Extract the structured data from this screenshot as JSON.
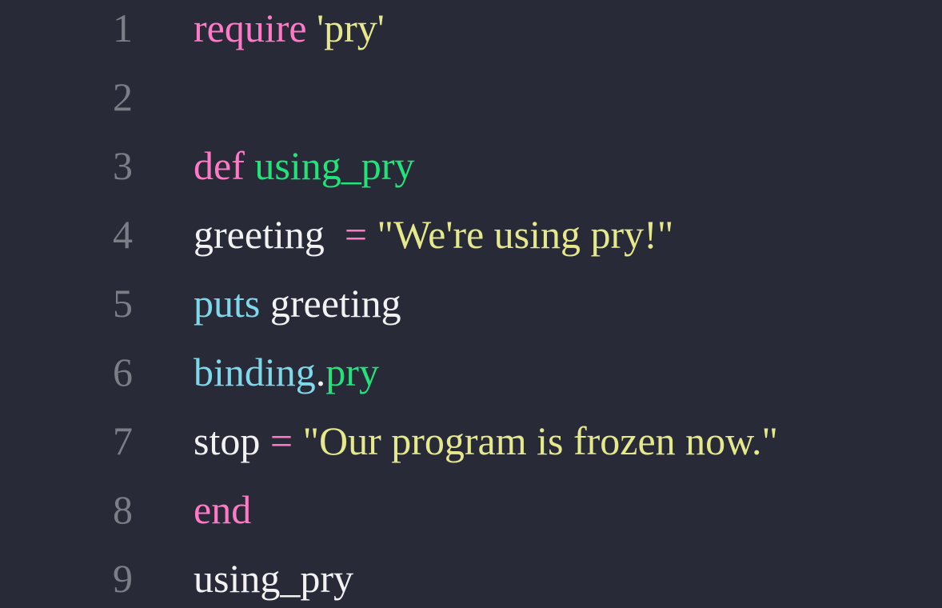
{
  "editor": {
    "colors": {
      "background": "#282a38",
      "line_number": "#7b7e87",
      "keyword": "#ff79c6",
      "string": "#e6e88c",
      "method": "#22e37a",
      "identifier": "#f2f2f2",
      "builtin": "#7fd7ea"
    },
    "lines": [
      {
        "number": "1",
        "tokens": [
          {
            "text": "require",
            "kind": "keyword"
          },
          {
            "text": " ",
            "kind": "identifier"
          },
          {
            "text": "'pry'",
            "kind": "string"
          }
        ]
      },
      {
        "number": "2",
        "tokens": []
      },
      {
        "number": "3",
        "tokens": [
          {
            "text": "def",
            "kind": "keyword"
          },
          {
            "text": " ",
            "kind": "identifier"
          },
          {
            "text": "using_pry",
            "kind": "method"
          }
        ]
      },
      {
        "number": "4",
        "tokens": [
          {
            "text": "greeting  ",
            "kind": "identifier"
          },
          {
            "text": "=",
            "kind": "keyword"
          },
          {
            "text": " ",
            "kind": "identifier"
          },
          {
            "text": "\"We're using pry!\"",
            "kind": "string"
          }
        ]
      },
      {
        "number": "5",
        "tokens": [
          {
            "text": "puts",
            "kind": "builtin"
          },
          {
            "text": " greeting",
            "kind": "identifier"
          }
        ]
      },
      {
        "number": "6",
        "tokens": [
          {
            "text": "binding",
            "kind": "builtin"
          },
          {
            "text": ".",
            "kind": "identifier"
          },
          {
            "text": "pry",
            "kind": "method"
          }
        ]
      },
      {
        "number": "7",
        "tokens": [
          {
            "text": "stop ",
            "kind": "identifier"
          },
          {
            "text": "=",
            "kind": "keyword"
          },
          {
            "text": " ",
            "kind": "identifier"
          },
          {
            "text": "\"Our program is frozen now.\"",
            "kind": "string"
          }
        ]
      },
      {
        "number": "8",
        "tokens": [
          {
            "text": "end",
            "kind": "keyword"
          }
        ]
      },
      {
        "number": "9",
        "tokens": [
          {
            "text": "using_pry",
            "kind": "identifier"
          }
        ]
      }
    ]
  }
}
